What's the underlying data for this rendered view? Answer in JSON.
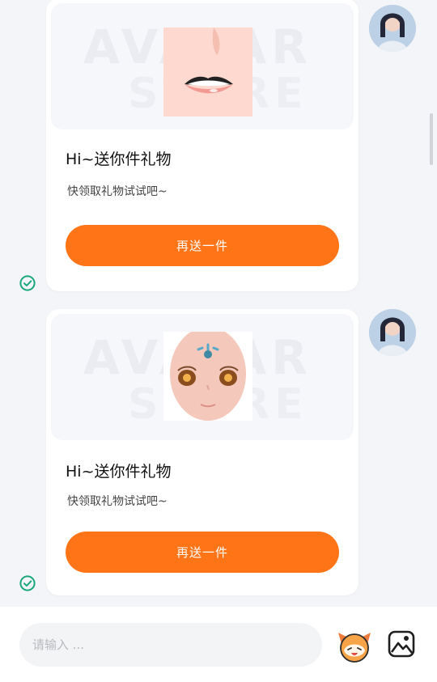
{
  "messages": [
    {
      "title": "Hi~送你件礼物",
      "subtitle": "快领取礼物试试吧~",
      "button_label": "再送一件",
      "gift_item": "lips-sticker",
      "status": "sent"
    },
    {
      "title": "Hi~送你件礼物",
      "subtitle": "快领取礼物试试吧~",
      "button_label": "再送一件",
      "gift_item": "face-sticker",
      "status": "sent"
    }
  ],
  "watermark": "AVATAR STORE",
  "input": {
    "placeholder": "请输入 ..."
  },
  "colors": {
    "accent": "#ff7417",
    "sent_check": "#18a77a",
    "background": "#f4f5f8"
  },
  "icons": {
    "sent": "check-circle-icon",
    "mascot": "mascot-icon",
    "image": "image-icon"
  }
}
